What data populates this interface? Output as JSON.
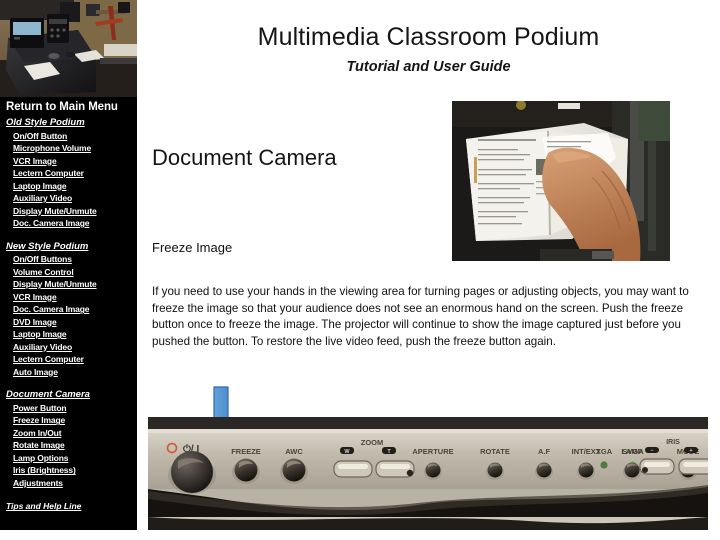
{
  "header": {
    "title": "Multimedia Classroom Podium",
    "subtitle": "Tutorial and User Guide"
  },
  "sidebar": {
    "main_menu_label": "Return to Main Menu",
    "groups": [
      {
        "title": "Old Style Podium",
        "items": [
          "On/Off Button",
          "Microphone Volume",
          "VCR Image",
          "Lectern Computer",
          "Laptop Image",
          "Auxiliary Video",
          "Display Mute/Unmute",
          "Doc. Camera Image"
        ]
      },
      {
        "title": "New Style Podium",
        "items": [
          "On/Off Buttons",
          "Volume Control",
          "Display Mute/Unmute",
          "VCR Image",
          "Doc. Camera Image",
          "DVD Image",
          "Laptop Image",
          "Auxiliary Video",
          "Lectern Computer",
          "Auto Image"
        ]
      },
      {
        "title": "Document Camera",
        "items": [
          "Power Button",
          "Freeze Image",
          "Zoom In/Out",
          "Rotate Image",
          "Lamp Options",
          "Iris (Brightness)",
          "Adjustments"
        ]
      }
    ],
    "footer_link": "Tips and Help Line"
  },
  "main": {
    "section_title": "Document Camera",
    "sub_heading": "Freeze Image",
    "body_text": "If you need to use your hands in the viewing area for turning pages or adjusting objects, you may want to freeze the image so that your audience does not see an enormous hand on the screen. Push the freeze button once to freeze the image. The projector will continue to show the image captured just before you pushed the button. To restore the live video feed, push the freeze button again."
  },
  "control_panel": {
    "power_symbol": "⏻ / I",
    "buttons": [
      "FREEZE",
      "AWC",
      "APERTURE",
      "ROTATE",
      "A.F"
    ],
    "zoom_label": "ZOOM",
    "zoom_marks": [
      "W",
      "T"
    ],
    "indicators": [
      "XGA",
      "SVGA"
    ],
    "right_buttons": [
      "MODE",
      "INT/EXT",
      "LAMP"
    ],
    "iris_label": "IRIS",
    "iris_marks": [
      "−",
      "+"
    ]
  },
  "colors": {
    "sidebar_bg": "#000000",
    "sidebar_text": "#ffffff",
    "arrow_blue": "#5b9bd5",
    "arrow_blue_dark": "#2f6ca8",
    "text_dark": "#151515"
  }
}
